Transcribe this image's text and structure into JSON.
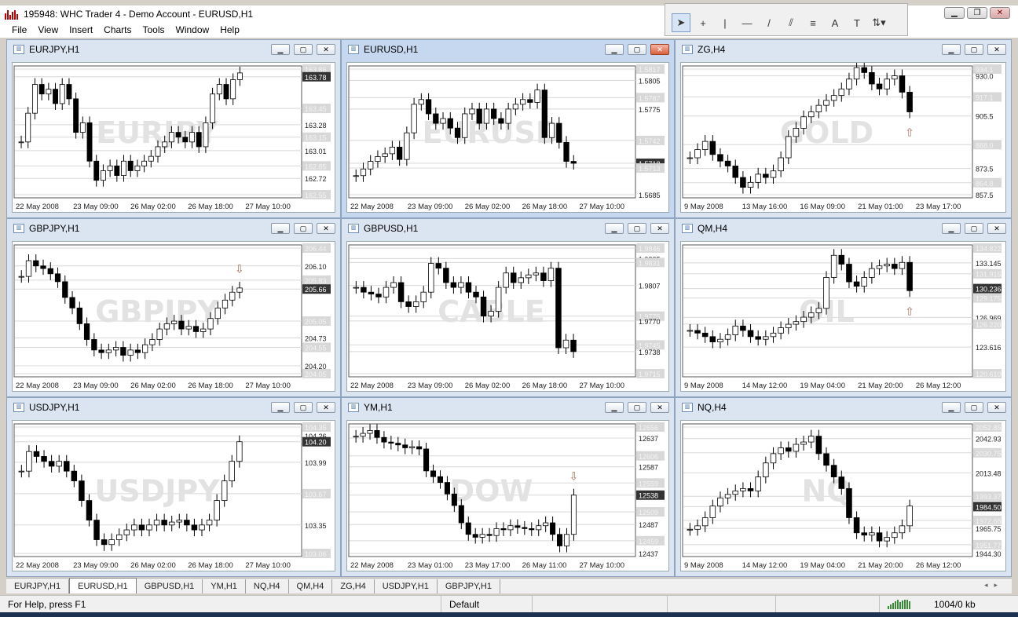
{
  "window": {
    "title": "195948: WHC Trader 4 - Demo Account - EURUSD,H1"
  },
  "menu": [
    "File",
    "View",
    "Insert",
    "Charts",
    "Tools",
    "Window",
    "Help"
  ],
  "toolbar": {
    "tools": [
      {
        "name": "cursor-tool-icon",
        "glyph": "➤"
      },
      {
        "name": "crosshair-tool-icon",
        "glyph": "+"
      },
      {
        "name": "vertical-line-tool-icon",
        "glyph": "|"
      },
      {
        "name": "horizontal-line-tool-icon",
        "glyph": "—"
      },
      {
        "name": "trendline-tool-icon",
        "glyph": "/"
      },
      {
        "name": "equidistant-channel-tool-icon",
        "glyph": "⫽"
      },
      {
        "name": "fibonacci-tool-icon",
        "glyph": "≡"
      },
      {
        "name": "text-tool-icon",
        "glyph": "A"
      },
      {
        "name": "text-label-tool-icon",
        "glyph": "T"
      },
      {
        "name": "arrows-tool-icon",
        "glyph": "⇅▾"
      }
    ]
  },
  "charts": [
    {
      "title": "EURJPY,H1",
      "watermark": "EURJPY",
      "active": false,
      "prices": [
        "163.86",
        "163.78",
        "163.45",
        "163.28",
        "163.15",
        "163.01",
        "162.85",
        "162.72",
        "162.55"
      ],
      "highlight": "163.78",
      "dates": [
        "22 May 2008",
        "23 May 09:00",
        "26 May 02:00",
        "26 May 18:00",
        "27 May 10:00"
      ],
      "series": [
        163.1,
        163.4,
        163.7,
        163.6,
        163.65,
        163.5,
        163.7,
        163.55,
        163.2,
        163.3,
        162.9,
        162.7,
        162.8,
        162.85,
        162.75,
        162.9,
        162.8,
        162.85,
        162.9,
        162.95,
        163.05,
        163.1,
        163.2,
        163.15,
        163.1,
        163.2,
        163.05,
        163.3,
        163.6,
        163.7,
        163.55,
        163.75,
        163.82
      ],
      "arrow": "down"
    },
    {
      "title": "EURUSD,H1",
      "watermark": "EURUSD",
      "active": true,
      "prices": [
        "1.5817",
        "1.5805",
        "1.5787",
        "1.5775",
        "1.5742",
        "1.5718",
        "1.5713",
        "1.5685"
      ],
      "highlight": "1.5718",
      "dates": [
        "22 May 2008",
        "23 May 09:00",
        "26 May 02:00",
        "26 May 18:00",
        "27 May 10:00"
      ],
      "series": [
        1.5705,
        1.5712,
        1.572,
        1.5725,
        1.5728,
        1.5735,
        1.5722,
        1.575,
        1.578,
        1.5785,
        1.577,
        1.576,
        1.5765,
        1.5755,
        1.5745,
        1.577,
        1.5775,
        1.576,
        1.5775,
        1.5765,
        1.576,
        1.5775,
        1.578,
        1.5785,
        1.5782,
        1.5795,
        1.5745,
        1.576,
        1.574,
        1.572,
        1.5718
      ],
      "arrow": ""
    },
    {
      "title": "ZG,H4",
      "watermark": "GOLD",
      "active": false,
      "prices": [
        "934.1",
        "930.0",
        "917.1",
        "905.5",
        "888.0",
        "873.5",
        "864.8",
        "857.5"
      ],
      "highlight": "",
      "dates": [
        "9 May 2008",
        "13 May 16:00",
        "16 May 09:00",
        "21 May 01:00",
        "23 May 17:00"
      ],
      "series": [
        880,
        885,
        890,
        882,
        878,
        875,
        868,
        862,
        865,
        870,
        868,
        872,
        880,
        893,
        898,
        905,
        908,
        912,
        915,
        918,
        922,
        928,
        935,
        932,
        925,
        922,
        928,
        930,
        920,
        908
      ],
      "arrow": "up"
    },
    {
      "title": "GBPJPY,H1",
      "watermark": "GBPJPY",
      "active": false,
      "prices": [
        "206.44",
        "206.10",
        "205.83",
        "205.66",
        "205.05",
        "204.73",
        "204.55",
        "204.20",
        "204.05"
      ],
      "highlight": "205.66",
      "dates": [
        "22 May 2008",
        "23 May 09:00",
        "26 May 02:00",
        "26 May 18:00",
        "27 May 10:00"
      ],
      "series": [
        205.9,
        206.2,
        206.1,
        206.05,
        205.95,
        205.8,
        205.5,
        205.3,
        205.0,
        204.7,
        204.5,
        204.45,
        204.5,
        204.55,
        204.4,
        204.5,
        204.45,
        204.6,
        204.7,
        204.9,
        205.0,
        205.05,
        204.9,
        204.95,
        204.85,
        204.9,
        205.1,
        205.3,
        205.45,
        205.6,
        205.68
      ],
      "arrow": "down"
    },
    {
      "title": "GBPUSD,H1",
      "watermark": "CABLE",
      "active": false,
      "prices": [
        "1.9846",
        "1.9835",
        "1.9831",
        "1.9807",
        "1.9775",
        "1.9770",
        "1.9745",
        "1.9738",
        "1.9715"
      ],
      "highlight": "",
      "dates": [
        "22 May 2008",
        "23 May 09:00",
        "26 May 02:00",
        "26 May 18:00",
        "27 May 10:00"
      ],
      "series": [
        1.9805,
        1.98,
        1.9798,
        1.9795,
        1.9805,
        1.981,
        1.979,
        1.9785,
        1.979,
        1.98,
        1.983,
        1.9825,
        1.981,
        1.9805,
        1.981,
        1.98,
        1.9795,
        1.9775,
        1.978,
        1.9805,
        1.982,
        1.981,
        1.9815,
        1.9818,
        1.982,
        1.9812,
        1.9825,
        1.9742,
        1.975,
        1.9738
      ],
      "arrow": ""
    },
    {
      "title": "QM,H4",
      "watermark": "OIL",
      "active": false,
      "prices": [
        "134.822",
        "133.145",
        "131.915",
        "130.236",
        "129.175",
        "126.969",
        "126.220",
        "123.616",
        "120.610"
      ],
      "highlight": "130.236",
      "dates": [
        "9 May 2008",
        "14 May 12:00",
        "19 May 04:00",
        "21 May 20:00",
        "26 May 12:00"
      ],
      "series": [
        125.5,
        125.2,
        124.8,
        124.2,
        124.5,
        125.0,
        126.0,
        125.5,
        124.8,
        124.5,
        124.8,
        125.2,
        125.8,
        126.2,
        126.5,
        127.0,
        127.5,
        128.0,
        131.5,
        134.0,
        133.0,
        131.0,
        130.5,
        131.5,
        132.5,
        132.8,
        133.0,
        132.5,
        133.2,
        130.0
      ],
      "arrow": "up"
    },
    {
      "title": "USDJPY,H1",
      "watermark": "USDJPY",
      "active": false,
      "prices": [
        "104.35",
        "104.26",
        "104.20",
        "103.99",
        "103.67",
        "103.35",
        "103.06"
      ],
      "highlight": "104.20",
      "dates": [
        "22 May 2008",
        "23 May 09:00",
        "26 May 02:00",
        "26 May 18:00",
        "27 May 10:00"
      ],
      "series": [
        103.9,
        104.1,
        104.05,
        104.0,
        103.95,
        104.0,
        103.9,
        103.8,
        103.6,
        103.4,
        103.2,
        103.15,
        103.2,
        103.25,
        103.3,
        103.35,
        103.3,
        103.35,
        103.4,
        103.35,
        103.38,
        103.4,
        103.35,
        103.3,
        103.35,
        103.4,
        103.6,
        103.8,
        104.0,
        104.2
      ],
      "arrow": ""
    },
    {
      "title": "YM,H1",
      "watermark": "DOW",
      "active": false,
      "prices": [
        "12656",
        "12637",
        "12606",
        "12587",
        "12559",
        "12538",
        "12509",
        "12487",
        "12459",
        "12437"
      ],
      "highlight": "12538",
      "dates": [
        "22 May 2008",
        "23 May 01:00",
        "23 May 17:00",
        "26 May 11:00",
        "27 May 10:00"
      ],
      "series": [
        12640,
        12645,
        12650,
        12638,
        12630,
        12628,
        12625,
        12620,
        12622,
        12618,
        12580,
        12570,
        12560,
        12540,
        12520,
        12490,
        12470,
        12465,
        12470,
        12468,
        12480,
        12478,
        12485,
        12482,
        12480,
        12478,
        12485,
        12490,
        12470,
        12450,
        12470,
        12538
      ],
      "arrow": "down"
    },
    {
      "title": "NQ,H4",
      "watermark": "NQ",
      "active": false,
      "prices": [
        "2052.85",
        "2042.93",
        "2030.75",
        "2013.48",
        "1993.37",
        "1984.50",
        "1972.68",
        "1965.75",
        "1951.77",
        "1944.30"
      ],
      "highlight": "1984.50",
      "dates": [
        "9 May 2008",
        "14 May 12:00",
        "19 May 04:00",
        "21 May 20:00",
        "26 May 12:00"
      ],
      "series": [
        1965,
        1968,
        1975,
        1985,
        1992,
        1995,
        1998,
        2000,
        1998,
        2010,
        2022,
        2030,
        2035,
        2032,
        2038,
        2040,
        2045,
        2030,
        2020,
        2010,
        2000,
        1975,
        1962,
        1960,
        1962,
        1955,
        1958,
        1962,
        1968,
        1985
      ],
      "arrow": ""
    }
  ],
  "tabs": [
    "EURJPY,H1",
    "EURUSD,H1",
    "GBPUSD,H1",
    "YM,H1",
    "NQ,H4",
    "QM,H4",
    "ZG,H4",
    "USDJPY,H1",
    "GBPJPY,H1"
  ],
  "active_tab": "EURUSD,H1",
  "status": {
    "help": "For Help, press F1",
    "profile": "Default",
    "traffic": "1004/0 kb"
  }
}
